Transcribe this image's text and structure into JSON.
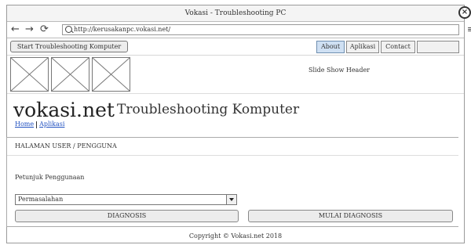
{
  "window": {
    "title": "Vokasi - Troubleshooting PC"
  },
  "browser": {
    "url": "http://kerusakanpc.vokasi.net/",
    "nav_icons": [
      "back-arrow-icon",
      "forward-arrow-icon",
      "reload-icon"
    ],
    "close_glyph": "×",
    "menu_glyph": "≡"
  },
  "toolbar": {
    "start_button": "Start Troubleshooting Komputer",
    "tabs": [
      {
        "label": "About",
        "active": true
      },
      {
        "label": "Aplikasi",
        "active": false
      },
      {
        "label": "Contact",
        "active": false
      }
    ]
  },
  "header": {
    "slide_title": "Slide Show Header"
  },
  "brand": {
    "name": "vokasi.net",
    "subtitle": "Troubleshooting Komputer",
    "breadcrumb": [
      "Home",
      "Aplikasi"
    ]
  },
  "panel": {
    "title": "HALAMAN USER / PENGGUNA",
    "guide": "Petunjuk Penggunaan",
    "select_value": "Permasalahan",
    "diagnose_button": "DIAGNOSIS",
    "start_diagnose_button": "MULAI DIAGNOSIS"
  },
  "footer": {
    "copyright": "Copyright © Vokasi.net 2018"
  },
  "colors": {
    "active_tab": "#cfe0f3",
    "link": "#2050c0"
  }
}
